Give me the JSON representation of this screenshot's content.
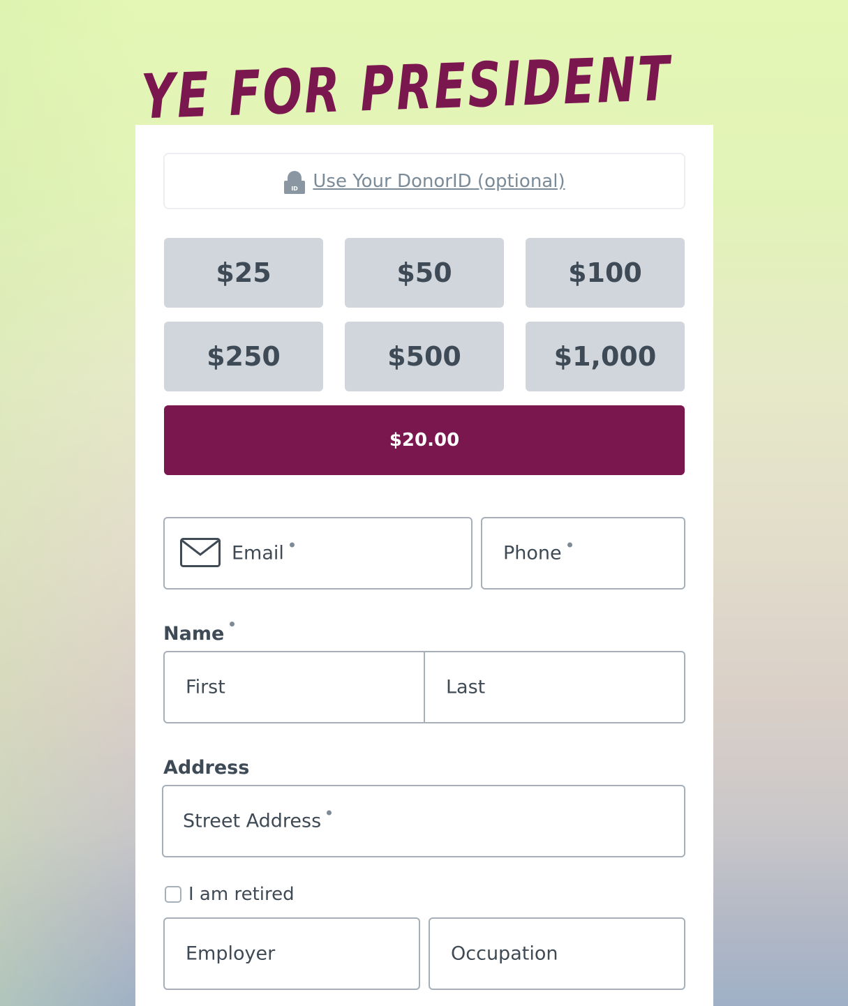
{
  "header": {
    "title": "YE FOR PRESIDENT",
    "title_color": "#7b174f"
  },
  "donor_id": {
    "link_label": "Use Your DonorID (optional)",
    "icon": "lock-icon",
    "icon_badge": "ID"
  },
  "amounts": {
    "options": [
      "$25",
      "$50",
      "$100",
      "$250",
      "$500",
      "$1,000"
    ],
    "selected_value": "$20.00",
    "button_color": "#d0d6dc",
    "selected_color": "#7b174f"
  },
  "contact": {
    "email_placeholder": "Email",
    "phone_placeholder": "Phone"
  },
  "name": {
    "label": "Name",
    "first_placeholder": "First",
    "last_placeholder": "Last"
  },
  "address": {
    "label": "Address",
    "street_placeholder": "Street Address"
  },
  "employment": {
    "retired_label": "I am retired",
    "retired_checked": false,
    "employer_placeholder": "Employer",
    "occupation_placeholder": "Occupation"
  }
}
